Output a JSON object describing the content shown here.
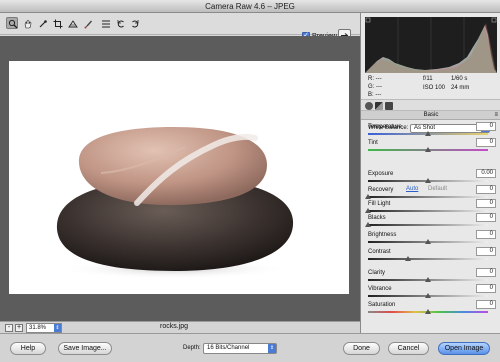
{
  "window": {
    "title": "Camera Raw 4.6  –  JPEG"
  },
  "toolbar": {
    "tools": [
      "zoom-tool",
      "hand-tool",
      "white-balance-tool",
      "crop-tool",
      "straighten-tool",
      "retouch-tool",
      "preferences",
      "rotate-left",
      "rotate-right"
    ],
    "preview_label": "Preview",
    "preview_checked": true
  },
  "status": {
    "zoom": "31.8%",
    "filename": "rocks.jpg"
  },
  "readouts": {
    "r": "R:   ---",
    "g": "G:   ---",
    "b": "B:   ---",
    "aperture": "f/11",
    "shutter": "1/60 s",
    "iso": "ISO 100",
    "focal": "24 mm"
  },
  "panel": {
    "section_title": "Basic",
    "white_balance_label": "White Balance:",
    "white_balance_value": "As Shot",
    "auto_label": "Auto",
    "default_label": "Default",
    "sliders": [
      {
        "key": "temperature",
        "label": "Temperature",
        "value": "0",
        "level": 0.5
      },
      {
        "key": "tint",
        "label": "Tint",
        "value": "0",
        "level": 0.5
      },
      {
        "key": "exposure",
        "label": "Exposure",
        "value": "0.00",
        "level": 0.5
      },
      {
        "key": "recovery",
        "label": "Recovery",
        "value": "0",
        "level": 0.0
      },
      {
        "key": "fill-light",
        "label": "Fill Light",
        "value": "0",
        "level": 0.0
      },
      {
        "key": "blacks",
        "label": "Blacks",
        "value": "0",
        "level": 0.0
      },
      {
        "key": "brightness",
        "label": "Brightness",
        "value": "0",
        "level": 0.5
      },
      {
        "key": "contrast",
        "label": "Contrast",
        "value": "0",
        "level": 0.33
      },
      {
        "key": "clarity",
        "label": "Clarity",
        "value": "0",
        "level": 0.5
      },
      {
        "key": "vibrance",
        "label": "Vibrance",
        "value": "0",
        "level": 0.5
      },
      {
        "key": "saturation",
        "label": "Saturation",
        "value": "0",
        "level": 0.5
      }
    ]
  },
  "bottom": {
    "help": "Help",
    "save_image": "Save Image...",
    "depth_label": "Depth:",
    "depth_value": "16 Bits/Channel",
    "done": "Done",
    "cancel": "Cancel",
    "open_image": "Open Image"
  },
  "colors": {
    "accent": "#4a7cd6",
    "canvas": "#5c5c5c",
    "histogram_bg": "#1e1e1e"
  }
}
